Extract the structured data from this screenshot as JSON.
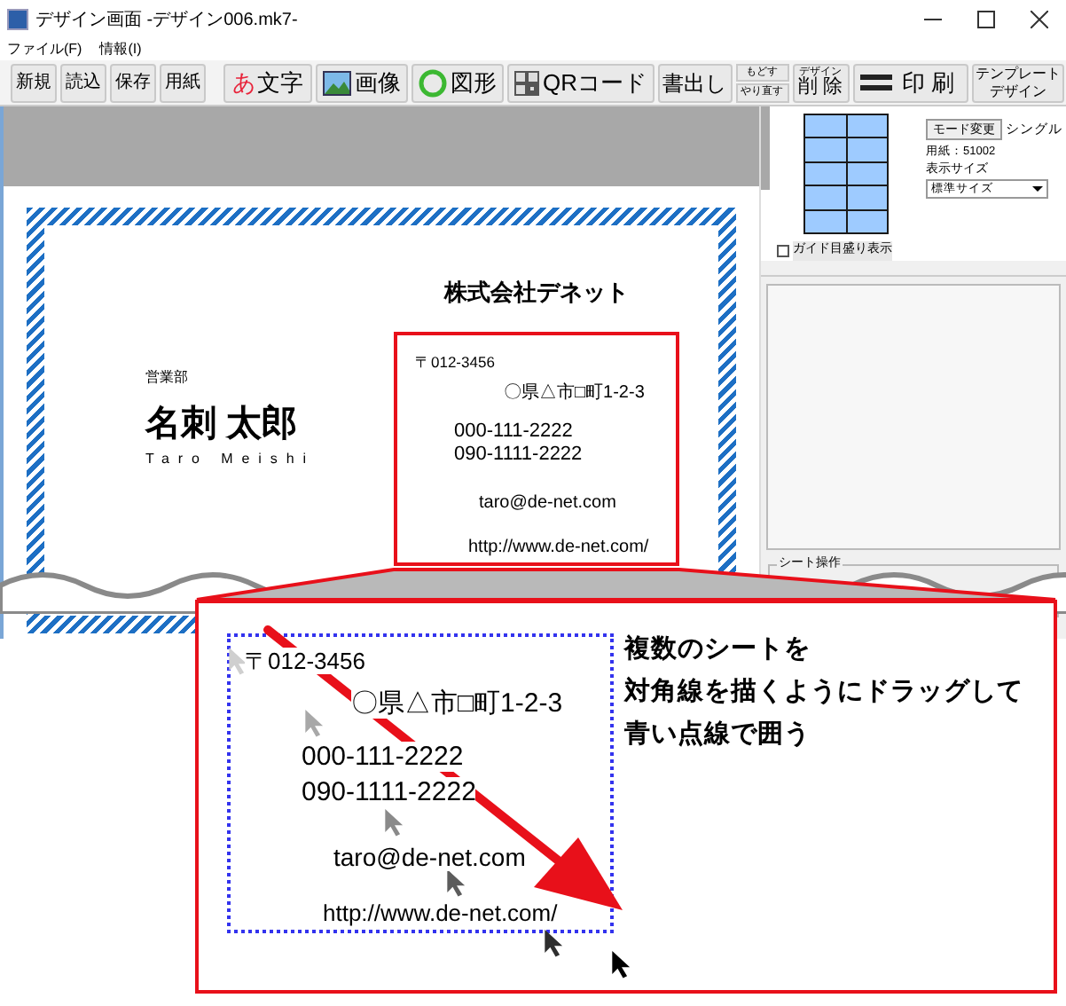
{
  "window": {
    "title": "デザイン画面 -デザイン006.mk7-"
  },
  "menu": [
    "ファイル(F)",
    "情報(I)"
  ],
  "toolbar": {
    "file_buttons": [
      "新規",
      "読込",
      "保存",
      "用紙"
    ],
    "tools": [
      {
        "kind": "glyph",
        "glyph": "あ",
        "label": "文字"
      },
      {
        "kind": "image",
        "label": "画像"
      },
      {
        "kind": "shape",
        "label": "図形"
      },
      {
        "kind": "qr",
        "label": "QRコード"
      },
      {
        "kind": "plain",
        "label": "書出し"
      },
      {
        "kind": "stack",
        "lines": [
          "もどす",
          "やり直す"
        ]
      },
      {
        "kind": "caption",
        "caption": "デザイン",
        "label": "削 除"
      },
      {
        "kind": "print",
        "label": "印 刷"
      },
      {
        "kind": "multiline",
        "lines": [
          "テンプレート",
          "デザイン"
        ]
      }
    ]
  },
  "side_panel": {
    "mode_button": "モード変更",
    "mode": "シングル",
    "paper": "用紙：51002",
    "display_size_label": "表示サイズ",
    "display_size": "標準サイズ",
    "guide_checkbox": {
      "label": "ガイド目盛り表示",
      "checked": false
    },
    "sheet_group": "シート操作"
  },
  "card": {
    "company": "株式会社デネット",
    "department": "営業部",
    "name": "名刺 太郎",
    "name_roman": "Taro Meishi",
    "address_lines": [
      "〒012-3456",
      "〇県△市□町1-2-3",
      "000-111-2222",
      "090-1111-2222",
      "taro@de-net.com",
      "http://www.de-net.com/"
    ]
  },
  "callout": {
    "address_lines": [
      "〒012-3456",
      "〇県△市□町1-2-3",
      "000-111-2222",
      "090-1111-2222",
      "taro@de-net.com",
      "http://www.de-net.com/"
    ],
    "instruction": [
      "複数のシートを",
      "対角線を描くようにドラッグして",
      "青い点線で囲う"
    ]
  }
}
